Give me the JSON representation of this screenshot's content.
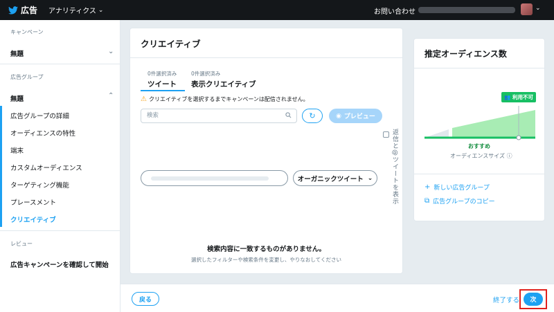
{
  "topbar": {
    "brand": "広告",
    "analytics": "アナリティクス",
    "contact": "お問い合わせ"
  },
  "sidebar": {
    "campaign_section": "キャンペーン",
    "campaign_name": "無題",
    "adgroup_section": "広告グループ",
    "adgroup_name": "無題",
    "items": [
      {
        "label": "広告グループの詳細"
      },
      {
        "label": "オーディエンスの特性"
      },
      {
        "label": "端末"
      },
      {
        "label": "カスタムオーディエンス"
      },
      {
        "label": "ターゲティング機能"
      },
      {
        "label": "プレースメント"
      },
      {
        "label": "クリエイティブ"
      }
    ],
    "review_section": "レビュー",
    "review_item": "広告キャンペーンを確認して開始"
  },
  "creative": {
    "title": "クリエイティブ",
    "tabs": [
      {
        "count": "0件選択済み",
        "label": "ツイート"
      },
      {
        "count": "0件選択済み",
        "label": "表示クリエイティブ"
      }
    ],
    "warning": "クリエイティブを選択するまでキャンペーンは配信されません。",
    "search_placeholder": "検索",
    "preview_label": "プレビュー",
    "reply_filter": "返信と@ツイートを表示",
    "organic_label": "オーガニックツイート",
    "empty_title": "検索内容に一致するものがありません。",
    "empty_sub": "選択したフィルターや検索条件を変更し、やりなおしてください"
  },
  "audience": {
    "title": "推定オーディエンス数",
    "unavailable": "利用不可",
    "recommended": "おすすめ",
    "size_label": "オーディエンスサイズ",
    "links": [
      {
        "label": "新しい広告グループ",
        "icon": "plus-icon"
      },
      {
        "label": "広告グループのコピー",
        "icon": "copy-icon"
      }
    ]
  },
  "footer": {
    "back": "戻る",
    "finish": "終了する",
    "next": "次"
  },
  "colors": {
    "accent": "#1da1f2",
    "topbar": "#14171a",
    "green": "#17bf63",
    "highlight": "#e0211d"
  }
}
